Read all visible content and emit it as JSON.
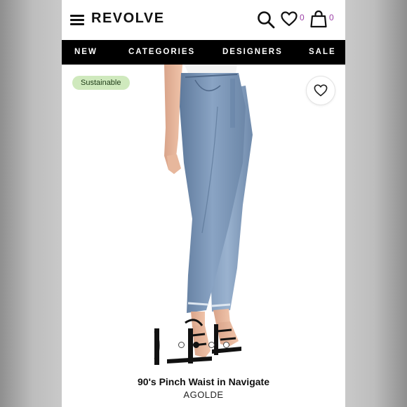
{
  "header": {
    "logo": "REVOLVE",
    "wishlist_count": "0",
    "bag_count": "0"
  },
  "nav": {
    "items": [
      "NEW",
      "CATEGORIES",
      "DESIGNERS",
      "SALE"
    ]
  },
  "product": {
    "badge": "Sustainable",
    "title": "90's Pinch Waist in Navigate",
    "brand": "AGOLDE",
    "gallery_total_images": 4,
    "gallery_active_index": 1
  },
  "colors": {
    "nav_background": "#000000",
    "badge_background": "#cfe9bd",
    "count_accent": "#9b3fa6",
    "denim": "#7d98b8"
  },
  "icons": [
    "menu-icon",
    "search-icon",
    "heart-icon",
    "bag-icon"
  ]
}
